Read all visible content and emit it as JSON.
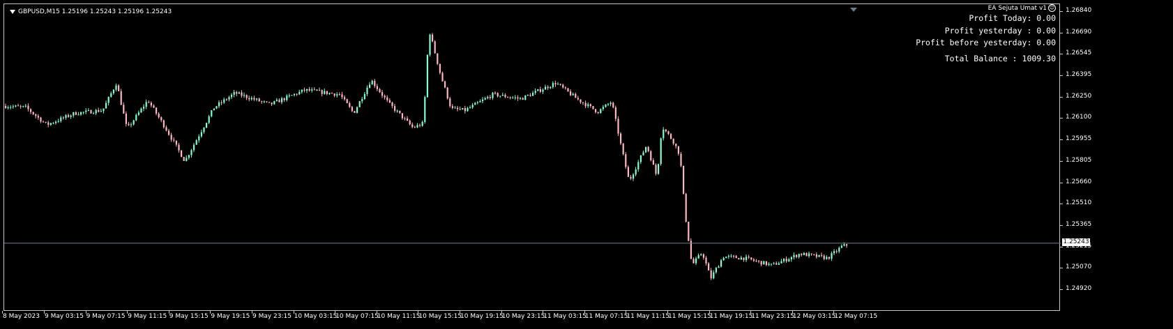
{
  "header": {
    "symbol_info": "GBPUSD,M15  1.25196 1.25243 1.25196 1.25243",
    "ea_name": "EA Sejuta Umat v1"
  },
  "info_panel": {
    "profit_today": "Profit Today: 0.00",
    "profit_yesterday": "Profit yesterday : 0.00",
    "profit_before_yesterday": "Profit before yesterday: 0.00",
    "total_balance": "Total Balance : 1009.30"
  },
  "price_axis": {
    "ticks": [
      "1.26840",
      "1.26690",
      "1.26545",
      "1.26395",
      "1.26250",
      "1.26100",
      "1.25955",
      "1.25805",
      "1.25660",
      "1.25510",
      "1.25365",
      "1.25215",
      "1.25070",
      "1.24920"
    ],
    "current_price": "1.25243"
  },
  "time_axis": {
    "ticks": [
      "8 May 2023",
      "9 May 03:15",
      "9 May 07:15",
      "9 May 11:15",
      "9 May 15:15",
      "9 May 19:15",
      "9 May 23:15",
      "10 May 03:15",
      "10 May 07:15",
      "10 May 11:15",
      "10 May 15:15",
      "10 May 19:15",
      "10 May 23:15",
      "11 May 03:15",
      "11 May 07:15",
      "11 May 11:15",
      "11 May 15:15",
      "11 May 19:15",
      "11 May 23:15",
      "12 May 03:15",
      "12 May 07:15"
    ]
  },
  "colors": {
    "bull": "#7fffd4",
    "bear": "#ffb6c1",
    "bid_line": "#708090",
    "background": "#000000",
    "frame": "#c8c8c8"
  },
  "chart_data": {
    "type": "candlestick",
    "ylim": [
      1.2492,
      1.2684
    ],
    "anchors": [
      [
        0,
        1.2619
      ],
      [
        30,
        1.2618
      ],
      [
        60,
        1.2606
      ],
      [
        100,
        1.2614
      ],
      [
        140,
        1.2616
      ],
      [
        160,
        1.2635
      ],
      [
        175,
        1.2603
      ],
      [
        205,
        1.2623
      ],
      [
        230,
        1.2604
      ],
      [
        258,
        1.2581
      ],
      [
        300,
        1.2618
      ],
      [
        330,
        1.2628
      ],
      [
        380,
        1.262
      ],
      [
        430,
        1.263
      ],
      [
        480,
        1.2627
      ],
      [
        500,
        1.2614
      ],
      [
        525,
        1.2637
      ],
      [
        550,
        1.2621
      ],
      [
        585,
        1.2604
      ],
      [
        600,
        1.2607
      ],
      [
        608,
        1.2672
      ],
      [
        625,
        1.264
      ],
      [
        640,
        1.2617
      ],
      [
        660,
        1.2616
      ],
      [
        700,
        1.2627
      ],
      [
        740,
        1.2624
      ],
      [
        790,
        1.2635
      ],
      [
        820,
        1.2624
      ],
      [
        850,
        1.2615
      ],
      [
        870,
        1.2622
      ],
      [
        885,
        1.2588
      ],
      [
        895,
        1.2567
      ],
      [
        920,
        1.2592
      ],
      [
        935,
        1.257
      ],
      [
        942,
        1.2605
      ],
      [
        958,
        1.2595
      ],
      [
        968,
        1.2585
      ],
      [
        975,
        1.2546
      ],
      [
        985,
        1.2509
      ],
      [
        1000,
        1.2518
      ],
      [
        1012,
        1.25
      ],
      [
        1030,
        1.2515
      ],
      [
        1060,
        1.2514
      ],
      [
        1100,
        1.2509
      ],
      [
        1140,
        1.2517
      ],
      [
        1180,
        1.2514
      ],
      [
        1200,
        1.2522
      ],
      [
        1214,
        1.2524
      ]
    ]
  }
}
